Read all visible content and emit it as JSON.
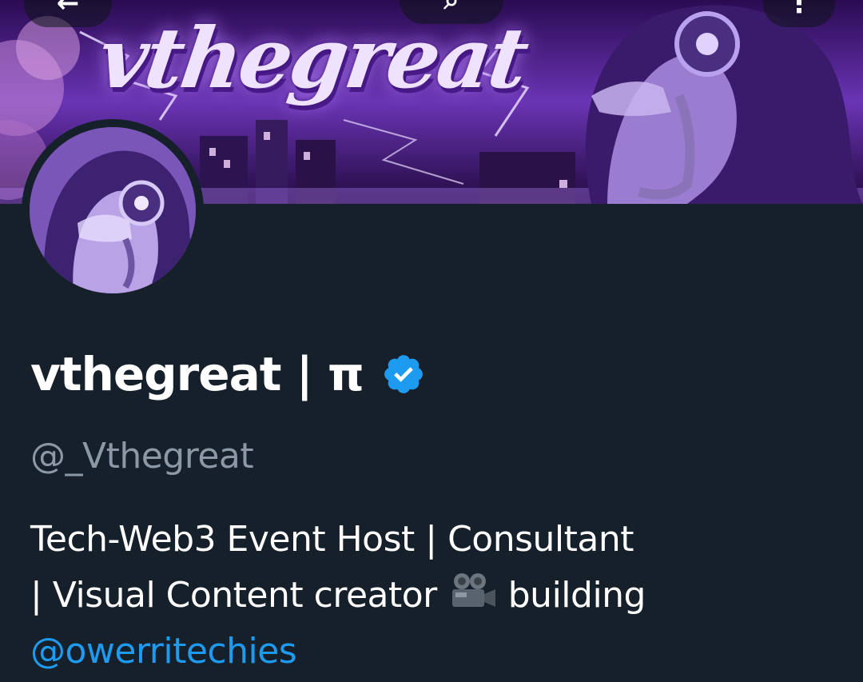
{
  "banner": {
    "logo_text": "vthegreat",
    "colors": {
      "primary": "#5a2a9a",
      "accent": "#c9a6ff",
      "glow": "#e9d9ff"
    }
  },
  "nav": {
    "back_icon": "back-arrow-icon",
    "search_icon": "search-icon",
    "more_icon": "more-options-icon"
  },
  "profile": {
    "display_name": "vthegreat | π",
    "verified": true,
    "verified_color": "#1d9bf0",
    "handle": "@_Vthegreat",
    "bio_line1": "Tech-Web3 Event Host | Consultant",
    "bio_line2_pre": "| Visual Content creator",
    "bio_emoji": "movie-camera-icon",
    "bio_line2_post": "building",
    "bio_mention": "@owerritechies"
  },
  "theme": {
    "background": "#15202b",
    "text": "#ffffff",
    "muted": "#8b98a5",
    "link": "#1d9bf0"
  }
}
